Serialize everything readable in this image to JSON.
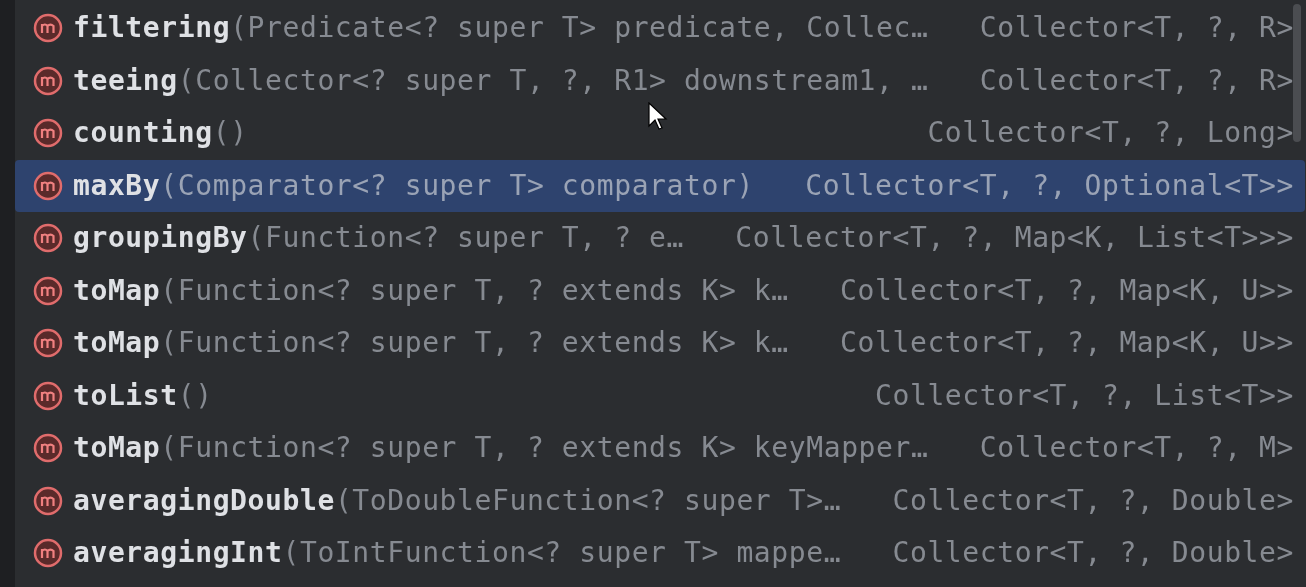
{
  "completion_list": {
    "items": [
      {
        "name": "filtering",
        "params": "(Predicate<? super T> predicate, Collec…",
        "return_type": "Collector<T, ?, R>",
        "selected": false
      },
      {
        "name": "teeing",
        "params": "(Collector<? super T, ?, R1> downstream1, …",
        "return_type": "Collector<T, ?, R>",
        "selected": false
      },
      {
        "name": "counting",
        "params": "()",
        "return_type": "Collector<T, ?, Long>",
        "selected": false
      },
      {
        "name": "maxBy",
        "params": "(Comparator<? super T> comparator)",
        "return_type": "Collector<T, ?, Optional<T>>",
        "selected": true
      },
      {
        "name": "groupingBy",
        "params": "(Function<? super T, ? e…",
        "return_type": "Collector<T, ?, Map<K, List<T>>>",
        "selected": false
      },
      {
        "name": "toMap",
        "params": "(Function<? super T, ? extends K> k…",
        "return_type": "Collector<T, ?, Map<K, U>>",
        "selected": false
      },
      {
        "name": "toMap",
        "params": "(Function<? super T, ? extends K> k…",
        "return_type": "Collector<T, ?, Map<K, U>>",
        "selected": false
      },
      {
        "name": "toList",
        "params": "()",
        "return_type": "Collector<T, ?, List<T>>",
        "selected": false
      },
      {
        "name": "toMap",
        "params": "(Function<? super T, ? extends K> keyMapper…",
        "return_type": "Collector<T, ?, M>",
        "selected": false
      },
      {
        "name": "averagingDouble",
        "params": "(ToDoubleFunction<? super T>…",
        "return_type": "Collector<T, ?, Double>",
        "selected": false
      },
      {
        "name": "averagingInt",
        "params": "(ToIntFunction<? super T> mappe…",
        "return_type": "Collector<T, ?, Double>",
        "selected": false
      }
    ]
  }
}
